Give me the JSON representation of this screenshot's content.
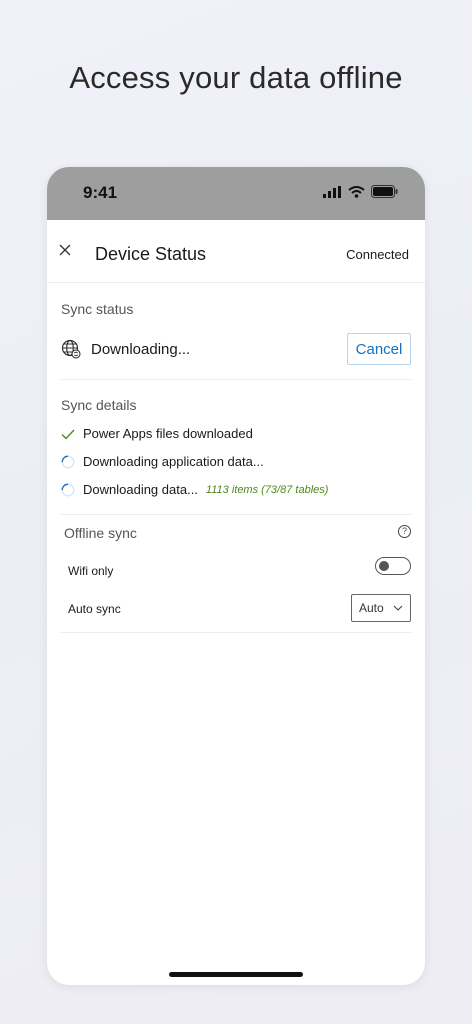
{
  "headline": "Access your data offline",
  "status_bar": {
    "time": "9:41"
  },
  "header": {
    "title": "Device Status",
    "connection": "Connected"
  },
  "sync_status": {
    "title": "Sync status",
    "label": "Downloading...",
    "cancel_label": "Cancel"
  },
  "sync_details": {
    "title": "Sync details",
    "items": [
      {
        "label": "Power Apps files downloaded",
        "state": "done"
      },
      {
        "label": "Downloading application data...",
        "state": "progress"
      },
      {
        "label": "Downloading data...",
        "state": "progress",
        "extra": "1113 items (73/87 tables)"
      }
    ]
  },
  "offline_sync": {
    "title": "Offline sync",
    "help": "?",
    "wifi_label": "Wifi only",
    "wifi_on": false,
    "auto_label": "Auto sync",
    "auto_value": "Auto"
  },
  "colors": {
    "accent": "#1470c4",
    "success": "#4f8a18",
    "statusbar": "#9e9e9e"
  }
}
